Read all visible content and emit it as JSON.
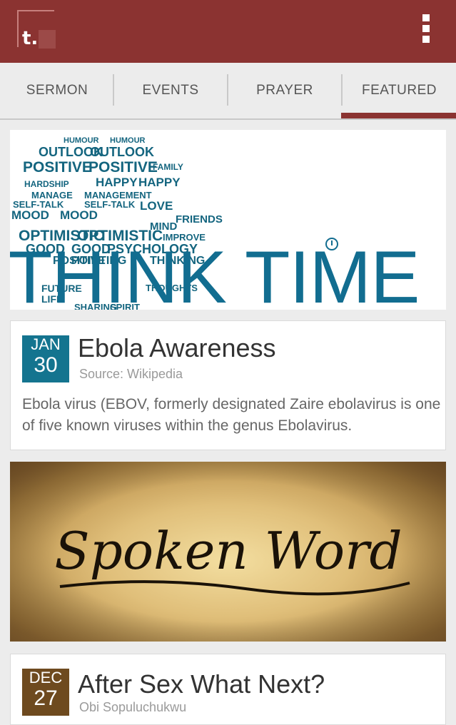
{
  "app": {
    "logo_glyph": "t."
  },
  "tabs": [
    {
      "label": "SERMON"
    },
    {
      "label": "EVENTS"
    },
    {
      "label": "PRAYER"
    },
    {
      "label": "FEATURED",
      "active": true
    }
  ],
  "colors": {
    "brand": "#8b3331",
    "accent_teal": "#126d90",
    "date_badge_1": "#14748f",
    "date_badge_2": "#6e4a1f"
  },
  "feed": {
    "banner": {
      "title": "THINK TIME",
      "cloud_words": [
        "HUMOUR",
        "HUMOUR",
        "OUTLOOK",
        "OUTLOOK",
        "POSITIVE",
        "POSITIVE",
        "FAMILY",
        "HAPPY",
        "HAPPY",
        "HARDSHIP",
        "MANAGEMENT",
        "MANAGE",
        "SELF-TALK",
        "SELF-TALK",
        "LOVE",
        "MOOD",
        "MOOD",
        "FRIENDS",
        "OPTIMISTIC",
        "OPTIMISTIC",
        "IMPROVE",
        "MIND",
        "GOOD",
        "GOOD",
        "PSYCHOLOGY",
        "POSITIVE",
        "POINTING",
        "THINKING",
        "FUTURE",
        "LIFE",
        "THOUGHTS",
        "SHARING",
        "SPIRIT"
      ]
    },
    "post1": {
      "month": "JAN",
      "day": "30",
      "title": "Ebola Awareness",
      "source": "Source: Wikipedia",
      "excerpt": "Ebola virus (EBOV, formerly designated Zaire ebolavirus is one of five known viruses within the genus Ebolavirus."
    },
    "image2": {
      "caption": "Spoken Word"
    },
    "post2": {
      "month": "DEC",
      "day": "27",
      "title": "After Sex What Next?",
      "source": "Obi Sopuluchukwu"
    }
  }
}
